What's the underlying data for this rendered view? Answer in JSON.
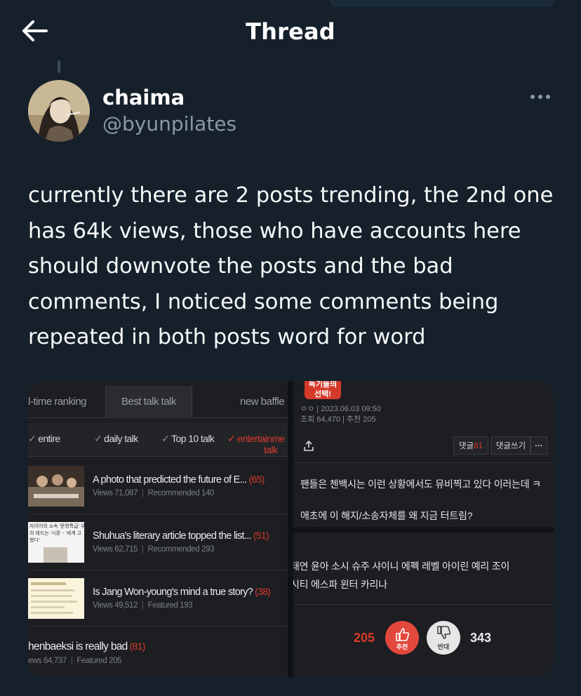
{
  "header": {
    "title": "Thread"
  },
  "tweet": {
    "author_name": "chaima",
    "author_handle": "@byunpilates",
    "text": "currently there are 2 posts trending, the 2nd one has 64k views, those who have accounts here should downvote the posts and the bad comments, I noticed some comments being repeated in both posts word for word"
  },
  "left_panel": {
    "tabs": [
      "l-time ranking",
      "Best talk talk",
      "new baffle"
    ],
    "filters": [
      "entire",
      "daily talk",
      "Top 10 talk",
      "entertainme",
      "talk"
    ],
    "posts": [
      {
        "title": "A photo that predicted the future of E...",
        "count": "(65)",
        "views": "Views 71,087",
        "extra": "Recommended 140"
      },
      {
        "title": "Shuhua's literary article topped the list...",
        "count": "(51)",
        "views": "Views 62,715",
        "extra": "Recommended 293"
      },
      {
        "title": "Is Jang Won-young's mind a true story?",
        "count": "(38)",
        "views": "Views 49,512",
        "extra": "Featured 193"
      },
      {
        "title": "henbaeksi is really bad",
        "count": "(81)",
        "views": "ews 64,737",
        "extra": "Featured 205"
      }
    ],
    "thumb_texts": [
      "자이어의 소속 '문명특급' 우",
      "의 레드는 '시쿵' - '세계 고",
      "했다'"
    ]
  },
  "right_panel": {
    "logo_text": [
      "독기들의",
      "선택!"
    ],
    "meta_line1": "ㅇㅇ  | 2023.06.03 09:50",
    "meta_line2": "조회 64,470 | 추천 205",
    "comment_label": "댓글",
    "comment_count": "81",
    "write_comment": "댓글쓰기",
    "more": "···",
    "lines1": [
      "팬들은 첸백시는 이런 상황에서도 뮤비찍고 있다 이러는데 ㅋ",
      "애초에 이 해지/소송자체를 왜 지금 터트림?"
    ],
    "lines2": [
      "태연 윤아 소시 슈주 샤이니 에펙 레벨 아이린 예리 조이",
      "시티 에스파 윈터 카리나"
    ],
    "upvotes": "205",
    "upvote_label": "추천",
    "downvote_label": "반대",
    "downvotes": "343"
  }
}
